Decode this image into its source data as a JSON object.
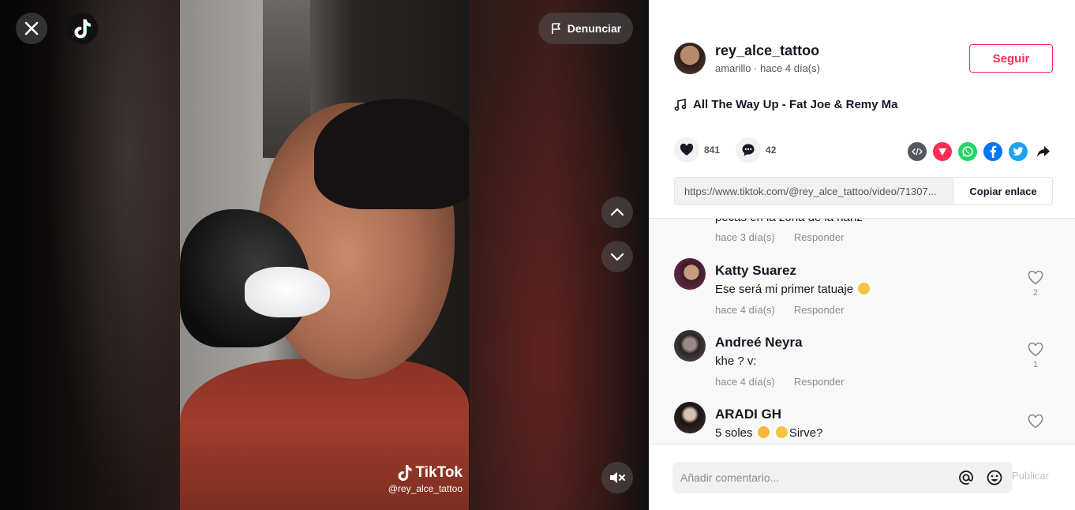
{
  "header": {
    "report_label": "Denunciar"
  },
  "video": {
    "watermark_brand": "TikTok",
    "watermark_user": "@rey_alce_tattoo"
  },
  "author": {
    "username": "rey_alce_tattoo",
    "nickname": "amarillo",
    "time": "hace 4 día(s)",
    "follow_label": "Seguir"
  },
  "music": {
    "title": "All The Way Up - Fat Joe & Remy Ma"
  },
  "stats": {
    "likes": "841",
    "comments": "42"
  },
  "share": {
    "icons": [
      "embed-icon",
      "send-icon",
      "whatsapp-icon",
      "facebook-icon",
      "twitter-icon",
      "share-icon"
    ],
    "colors": {
      "embed": "#555861",
      "send": "#fe2c55",
      "whatsapp": "#25d366",
      "facebook": "#0075fa",
      "twitter": "#1da1f2"
    }
  },
  "link": {
    "url": "https://www.tiktok.com/@rey_alce_tattoo/video/71307...",
    "copy_label": "Copiar enlace"
  },
  "comments": {
    "partial": {
      "text": "pecas en la zona de la nariz",
      "time": "hace 3 día(s)",
      "reply": "Responder"
    },
    "items": [
      {
        "name": "Katty Suarez",
        "text": "Ese será mi primer tatuaje",
        "time": "hace 4 día(s)",
        "reply": "Responder",
        "likes": "2"
      },
      {
        "name": "Andreé Neyra",
        "text": "khe ? v:",
        "time": "hace 4 día(s)",
        "reply": "Responder",
        "likes": "1"
      },
      {
        "name": "ARADI GH",
        "text_a": "5 soles",
        "text_b": "Sirve?",
        "likes": ""
      }
    ]
  },
  "composer": {
    "placeholder": "Añadir comentario...",
    "post_label": "Publicar"
  },
  "colors": {
    "accent": "#fe2c55",
    "text": "#161823",
    "muted": "#8a8b91"
  }
}
